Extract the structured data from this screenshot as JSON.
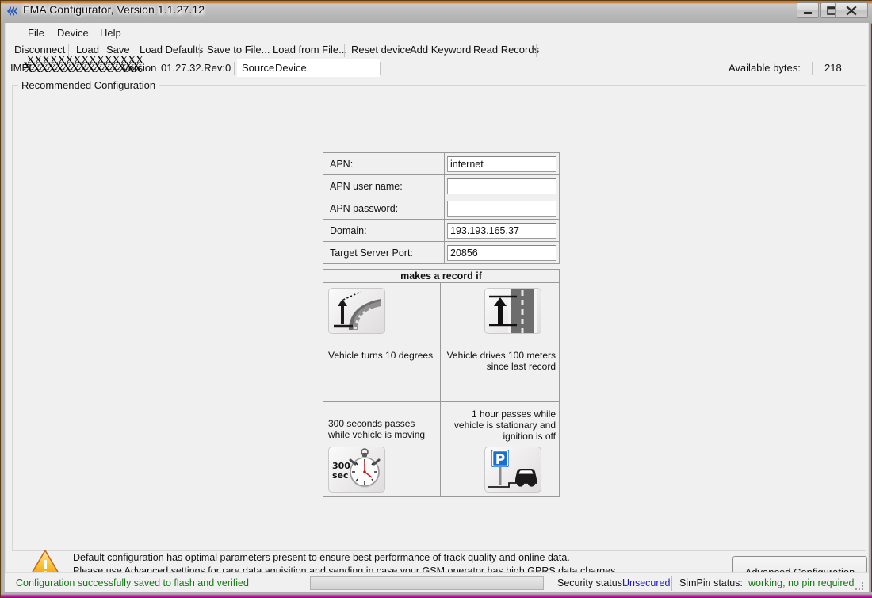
{
  "window": {
    "title": "FMA Configurator, Version 1.1.27.12",
    "icon": "app-chevron-icon",
    "minimize_label": "Minimize",
    "maximize_label": "Maximize",
    "close_label": "Close"
  },
  "menubar": {
    "items": [
      {
        "label": "File"
      },
      {
        "label": "Device"
      },
      {
        "label": "Help"
      }
    ]
  },
  "toolbar": {
    "items": [
      {
        "label": "Disconnect"
      },
      {
        "label": "Load"
      },
      {
        "label": "Save"
      },
      {
        "label": "Load Defaults"
      },
      {
        "label": "Save to File..."
      },
      {
        "label": "Load from File..."
      },
      {
        "label": "Reset device"
      },
      {
        "label": "Add Keyword"
      },
      {
        "label": "Read Records"
      }
    ]
  },
  "infostrip": {
    "imei_label": "IMEI",
    "imei_value": "XXXXXXXXXXXXXXX",
    "version_label": "Version",
    "version_value": "01.27.32.Rev:0",
    "source_label": "Source",
    "source_value": "Device.",
    "available_bytes_label": "Available bytes:",
    "available_bytes_value": "218"
  },
  "groupbox": {
    "label": "Recommended Configuration"
  },
  "settings": {
    "rows": [
      {
        "label": "APN:",
        "value": "internet",
        "placeholder": ""
      },
      {
        "label": "APN user name:",
        "value": "",
        "placeholder": ""
      },
      {
        "label": "APN password:",
        "value": "",
        "placeholder": ""
      },
      {
        "label": "Domain:",
        "value": "193.193.165.37",
        "placeholder": ""
      },
      {
        "label": "Target Server Port:",
        "value": "20856",
        "placeholder": ""
      }
    ]
  },
  "records": {
    "title": "makes a record if",
    "cells": [
      {
        "text": "Vehicle turns 10 degrees",
        "icon": "road-turn-icon"
      },
      {
        "text": "Vehicle drives 100 meters since last record",
        "icon": "road-distance-icon"
      },
      {
        "text": "300 seconds passes while vehicle is moving",
        "icon": "stopwatch-300-sec-icon",
        "icon_top_text": "300",
        "icon_bottom_text": "sec"
      },
      {
        "text": "1 hour passes while vehicle is stationary and ignition is off",
        "icon": "parked-car-icon",
        "sign_text": "P"
      }
    ]
  },
  "warning": {
    "icon": "warning-triangle-icon",
    "line1": "Default configuration has optimal parameters present to ensure best performance of track quality and online data.",
    "line2": "Please use Advanced settings for rare data aquisition and sending in case your GSM operator has high GPRS data charges."
  },
  "advanced_button": {
    "label": "Advanced Configuration"
  },
  "statusbar": {
    "message": "Configuration successfully saved to flash and verified",
    "security_label": "Security status:",
    "security_value": "Unsecured",
    "simpin_label": "SimPin status:",
    "simpin_value": "working, no pin required"
  },
  "colors": {
    "status_ok": "#127a12",
    "security_value": "#1414d0",
    "simpin_value": "#127a12",
    "window_bg": "#f0f0f0",
    "accent_orange": "#d96c10"
  }
}
